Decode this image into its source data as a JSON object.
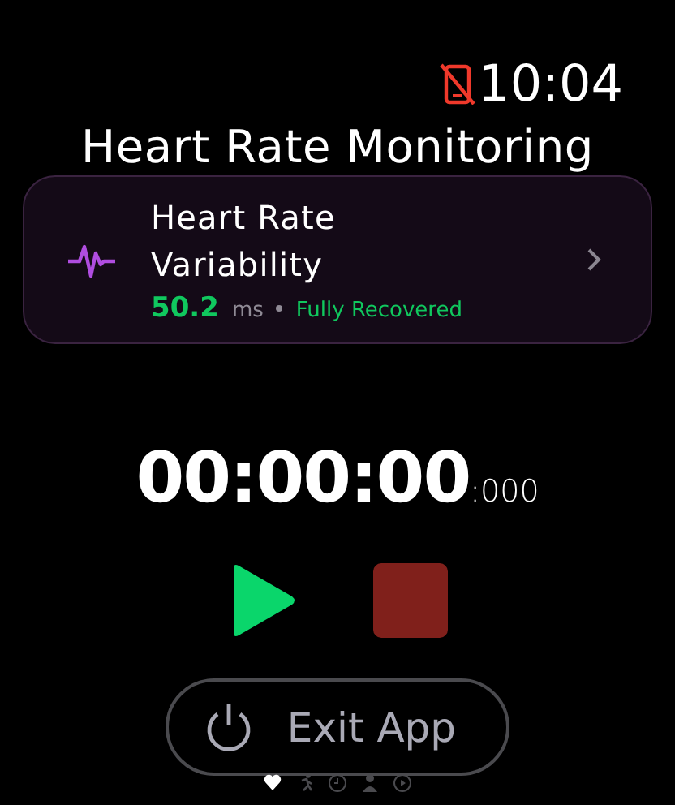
{
  "status_bar": {
    "time": "10:04",
    "phone_disconnected": true
  },
  "title": "Heart Rate Monitoring",
  "card": {
    "title": "Heart Rate Variability",
    "value": "50.2",
    "unit": "ms",
    "status": "Fully Recovered"
  },
  "timer": {
    "main": "00:00:00",
    "millis": ":000"
  },
  "controls": [
    {
      "kind": "play"
    },
    {
      "kind": "stop"
    }
  ],
  "exit_button": {
    "label": "Exit App"
  },
  "pages": [
    {
      "kind": "heart",
      "selected": true
    },
    {
      "kind": "runner",
      "selected": false
    },
    {
      "kind": "clock",
      "selected": false
    },
    {
      "kind": "person",
      "selected": false
    },
    {
      "kind": "play",
      "selected": false
    }
  ]
}
